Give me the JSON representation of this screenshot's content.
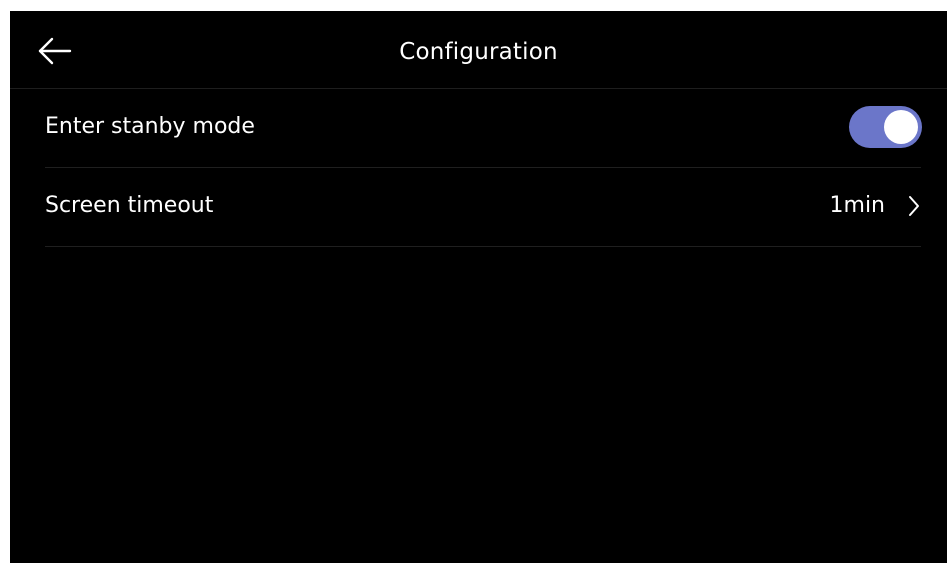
{
  "header": {
    "title": "Configuration",
    "back_icon": "arrow-left-icon"
  },
  "settings": [
    {
      "label": "Enter stanby mode",
      "control": "toggle",
      "enabled": true
    },
    {
      "label": "Screen timeout",
      "value": "1min",
      "icon": "chevron-right-icon"
    }
  ],
  "colors": {
    "background": "#000000",
    "toggle_on": "#6b76c9",
    "text": "#ffffff",
    "divider": "#1f1f1f"
  }
}
